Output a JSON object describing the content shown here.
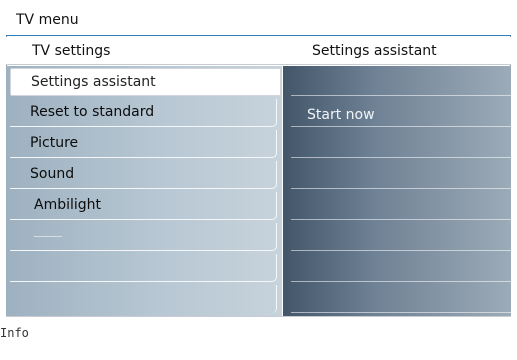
{
  "menu": {
    "title": "TV menu",
    "section_title": "TV settings",
    "panel_title": "Settings assistant",
    "items": [
      {
        "label": "Settings assistant",
        "selected": true
      },
      {
        "label": "Reset to standard",
        "selected": false
      },
      {
        "label": "Picture",
        "selected": false
      },
      {
        "label": "Sound",
        "selected": false
      },
      {
        "label": "Ambilight",
        "selected": false
      },
      {
        "label": "",
        "selected": false
      },
      {
        "label": "",
        "selected": false
      },
      {
        "label": "",
        "selected": false
      }
    ],
    "submenu_items": [
      {
        "label": "Start now"
      }
    ]
  },
  "footer": {
    "info_label": "Info"
  },
  "colors": {
    "title_rule": "#2c7db8",
    "left_panel": "#b7c7d3",
    "right_panel": "#6f8194",
    "selected_bg": "#ffffff"
  }
}
